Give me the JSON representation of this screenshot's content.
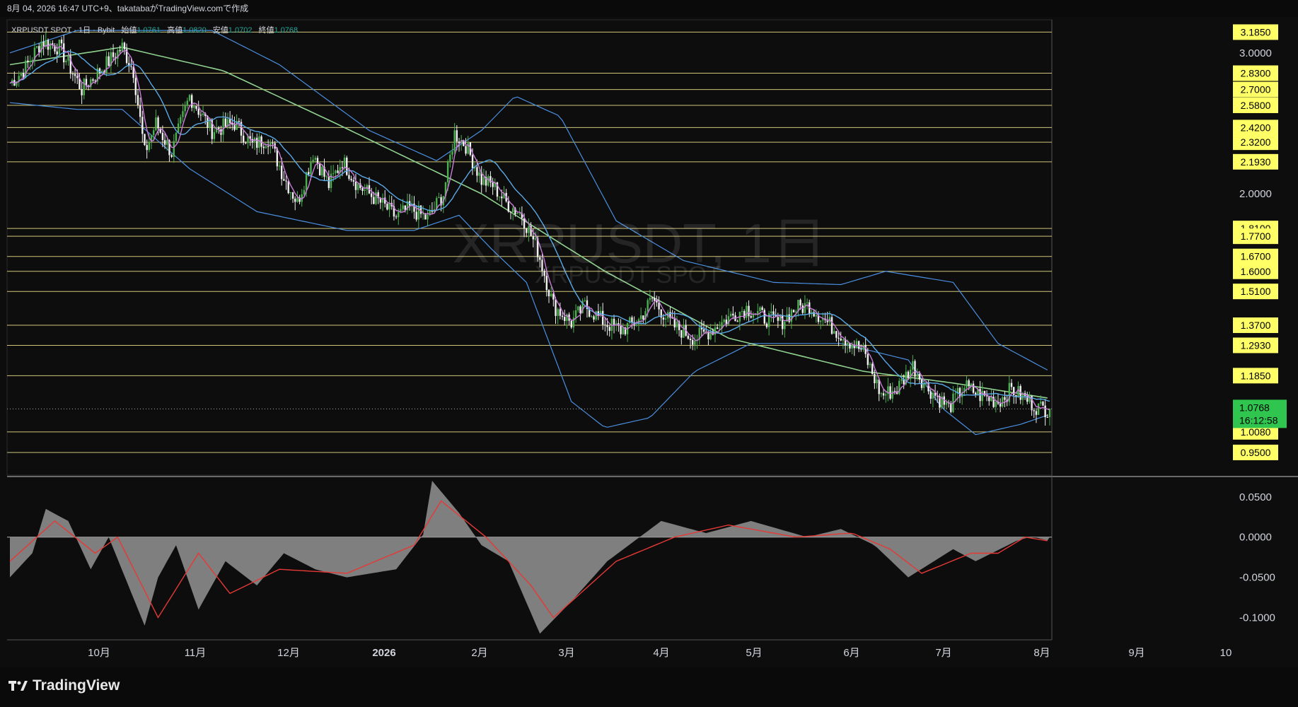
{
  "header": {
    "info": "8月 04, 2026 16:47 UTC+9、takatabaがTradingView.comで作成"
  },
  "legend": {
    "symbol": "XRPUSDT SPOT · 1日 · Bybit",
    "open_label": "始値",
    "open": "1.0761",
    "high_label": "高値",
    "high": "1.0820",
    "low_label": "安値",
    "low": "1.0702",
    "close_label": "終値",
    "close": "1.0768"
  },
  "watermark": {
    "main": "XRPUSDT, 1日",
    "sub": "XRPUSDT SPOT"
  },
  "brand": {
    "name": "TradingView"
  },
  "colors": {
    "level_line": "#f0e68c",
    "label_bg": "#ffff66",
    "candle_up": "#4caf50",
    "candle_down": "#f0f0f0",
    "bollinger": "#4a8fe0",
    "ma_long": "#8fd18f",
    "ma_short": "#c77dd6",
    "ma_mid": "#5aa9e6",
    "oscillator_fill": "#8c8c8c",
    "signal_line": "#e53935",
    "price_tag": "#2fc54e"
  },
  "chart_data": {
    "type": "candlestick",
    "title": "XRPUSDT SPOT · 1日 · Bybit",
    "x_axis_labels": [
      "10月",
      "11月",
      "12月",
      "2026",
      "2月",
      "3月",
      "4月",
      "5月",
      "6月",
      "7月",
      "8月",
      "9月",
      "10"
    ],
    "y_ticks": [
      "3.0000",
      "2.0000"
    ],
    "y_scale": "log",
    "y_range": [
      0.89,
      3.3
    ],
    "horizontal_levels": [
      3.185,
      2.83,
      2.7,
      2.58,
      2.42,
      2.32,
      2.193,
      1.81,
      1.77,
      1.67,
      1.6,
      1.51,
      1.37,
      1.293,
      1.185,
      1.008,
      0.95
    ],
    "level_labels": [
      "3.1850",
      "2.8300",
      "2.7000",
      "2.5800",
      "2.4200",
      "2.3200",
      "2.1930",
      "1.8100",
      "1.7700",
      "1.6700",
      "1.6000",
      "1.5100",
      "1.3700",
      "1.2930",
      "1.1850",
      "1.0080",
      "0.9500"
    ],
    "last_price": {
      "value": 1.0768,
      "label": "1.0768",
      "countdown": "16:12:58"
    },
    "price_path": [
      [
        2.75,
        0
      ],
      [
        2.85,
        6
      ],
      [
        3.1,
        14
      ],
      [
        3.05,
        22
      ],
      [
        2.7,
        32
      ],
      [
        2.85,
        40
      ],
      [
        3.05,
        50
      ],
      [
        2.85,
        55
      ],
      [
        2.25,
        60
      ],
      [
        2.45,
        65
      ],
      [
        2.25,
        72
      ],
      [
        2.65,
        80
      ],
      [
        2.4,
        90
      ],
      [
        2.45,
        100
      ],
      [
        2.3,
        108
      ],
      [
        2.35,
        115
      ],
      [
        2.1,
        122
      ],
      [
        1.95,
        128
      ],
      [
        2.25,
        135
      ],
      [
        2.05,
        142
      ],
      [
        2.2,
        148
      ],
      [
        2.05,
        155
      ],
      [
        1.95,
        165
      ],
      [
        1.87,
        172
      ],
      [
        1.92,
        178
      ],
      [
        1.86,
        186
      ],
      [
        2.0,
        193
      ],
      [
        2.38,
        198
      ],
      [
        2.3,
        203
      ],
      [
        2.08,
        210
      ],
      [
        2.05,
        215
      ],
      [
        1.95,
        221
      ],
      [
        1.88,
        228
      ],
      [
        1.7,
        235
      ],
      [
        1.45,
        242
      ],
      [
        1.38,
        250
      ],
      [
        1.45,
        256
      ],
      [
        1.38,
        265
      ],
      [
        1.35,
        272
      ],
      [
        1.39,
        280
      ],
      [
        1.48,
        286
      ],
      [
        1.37,
        295
      ],
      [
        1.32,
        305
      ],
      [
        1.35,
        312
      ],
      [
        1.4,
        320
      ],
      [
        1.44,
        328
      ],
      [
        1.4,
        336
      ],
      [
        1.38,
        343
      ],
      [
        1.44,
        350
      ],
      [
        1.45,
        356
      ],
      [
        1.38,
        364
      ],
      [
        1.32,
        372
      ],
      [
        1.27,
        380
      ],
      [
        1.12,
        388
      ],
      [
        1.14,
        395
      ],
      [
        1.22,
        402
      ],
      [
        1.15,
        408
      ],
      [
        1.08,
        418
      ],
      [
        1.15,
        425
      ],
      [
        1.12,
        432
      ],
      [
        1.1,
        440
      ],
      [
        1.14,
        446
      ],
      [
        1.11,
        452
      ],
      [
        1.08,
        458
      ],
      [
        1.077,
        463
      ]
    ],
    "ma_long_path": [
      [
        2.9,
        0
      ],
      [
        3.05,
        50
      ],
      [
        2.85,
        95
      ],
      [
        2.45,
        145
      ],
      [
        2.0,
        210
      ],
      [
        1.6,
        265
      ],
      [
        1.32,
        320
      ],
      [
        1.2,
        380
      ],
      [
        1.16,
        420
      ],
      [
        1.11,
        463
      ]
    ],
    "bb_upper_path": [
      [
        3.0,
        0
      ],
      [
        3.2,
        30
      ],
      [
        3.2,
        90
      ],
      [
        2.9,
        120
      ],
      [
        2.4,
        160
      ],
      [
        2.2,
        190
      ],
      [
        2.4,
        210
      ],
      [
        2.65,
        225
      ],
      [
        2.5,
        245
      ],
      [
        1.85,
        270
      ],
      [
        1.65,
        300
      ],
      [
        1.55,
        340
      ],
      [
        1.54,
        370
      ],
      [
        1.6,
        390
      ],
      [
        1.55,
        420
      ],
      [
        1.3,
        440
      ],
      [
        1.2,
        463
      ]
    ],
    "bb_lower_path": [
      [
        2.6,
        0
      ],
      [
        2.55,
        30
      ],
      [
        2.55,
        50
      ],
      [
        2.15,
        80
      ],
      [
        1.9,
        110
      ],
      [
        1.8,
        150
      ],
      [
        1.8,
        180
      ],
      [
        1.88,
        200
      ],
      [
        1.7,
        215
      ],
      [
        1.55,
        230
      ],
      [
        1.1,
        250
      ],
      [
        1.02,
        265
      ],
      [
        1.05,
        285
      ],
      [
        1.2,
        305
      ],
      [
        1.3,
        330
      ],
      [
        1.3,
        370
      ],
      [
        1.24,
        400
      ],
      [
        1.08,
        415
      ],
      [
        1.0,
        430
      ],
      [
        1.03,
        450
      ],
      [
        1.06,
        463
      ]
    ],
    "oscillator": {
      "y_ticks": [
        "0.0500",
        "0.0000",
        "-0.0500",
        "-0.1000"
      ],
      "y_range": [
        -0.125,
        0.07
      ],
      "histogram_path": [
        [
          -0.05,
          0
        ],
        [
          -0.02,
          10
        ],
        [
          0.035,
          16
        ],
        [
          0.02,
          26
        ],
        [
          -0.04,
          36
        ],
        [
          0.0,
          44
        ],
        [
          -0.11,
          60
        ],
        [
          -0.05,
          66
        ],
        [
          -0.01,
          74
        ],
        [
          -0.09,
          84
        ],
        [
          -0.03,
          96
        ],
        [
          -0.06,
          110
        ],
        [
          -0.02,
          122
        ],
        [
          -0.04,
          136
        ],
        [
          -0.05,
          150
        ],
        [
          -0.04,
          172
        ],
        [
          0.003,
          184
        ],
        [
          0.07,
          188
        ],
        [
          0.03,
          200
        ],
        [
          -0.01,
          210
        ],
        [
          -0.03,
          222
        ],
        [
          -0.12,
          236
        ],
        [
          -0.08,
          250
        ],
        [
          -0.03,
          266
        ],
        [
          0.02,
          290
        ],
        [
          0.005,
          310
        ],
        [
          0.02,
          330
        ],
        [
          0.0,
          355
        ],
        [
          0.01,
          370
        ],
        [
          -0.01,
          385
        ],
        [
          -0.05,
          400
        ],
        [
          -0.015,
          420
        ],
        [
          -0.03,
          430
        ],
        [
          -0.005,
          448
        ],
        [
          0.001,
          455
        ],
        [
          -0.005,
          463
        ]
      ],
      "signal_path": [
        [
          -0.03,
          0
        ],
        [
          0.02,
          20
        ],
        [
          -0.02,
          38
        ],
        [
          0.0,
          48
        ],
        [
          -0.1,
          66
        ],
        [
          -0.02,
          84
        ],
        [
          -0.07,
          98
        ],
        [
          -0.04,
          120
        ],
        [
          -0.045,
          150
        ],
        [
          -0.01,
          180
        ],
        [
          0.045,
          192
        ],
        [
          0.0,
          212
        ],
        [
          -0.06,
          232
        ],
        [
          -0.1,
          242
        ],
        [
          -0.03,
          270
        ],
        [
          0.0,
          296
        ],
        [
          0.015,
          320
        ],
        [
          0.0,
          350
        ],
        [
          0.005,
          375
        ],
        [
          -0.015,
          392
        ],
        [
          -0.045,
          406
        ],
        [
          -0.02,
          428
        ],
        [
          -0.02,
          440
        ],
        [
          0.0,
          452
        ],
        [
          -0.005,
          463
        ]
      ]
    }
  }
}
